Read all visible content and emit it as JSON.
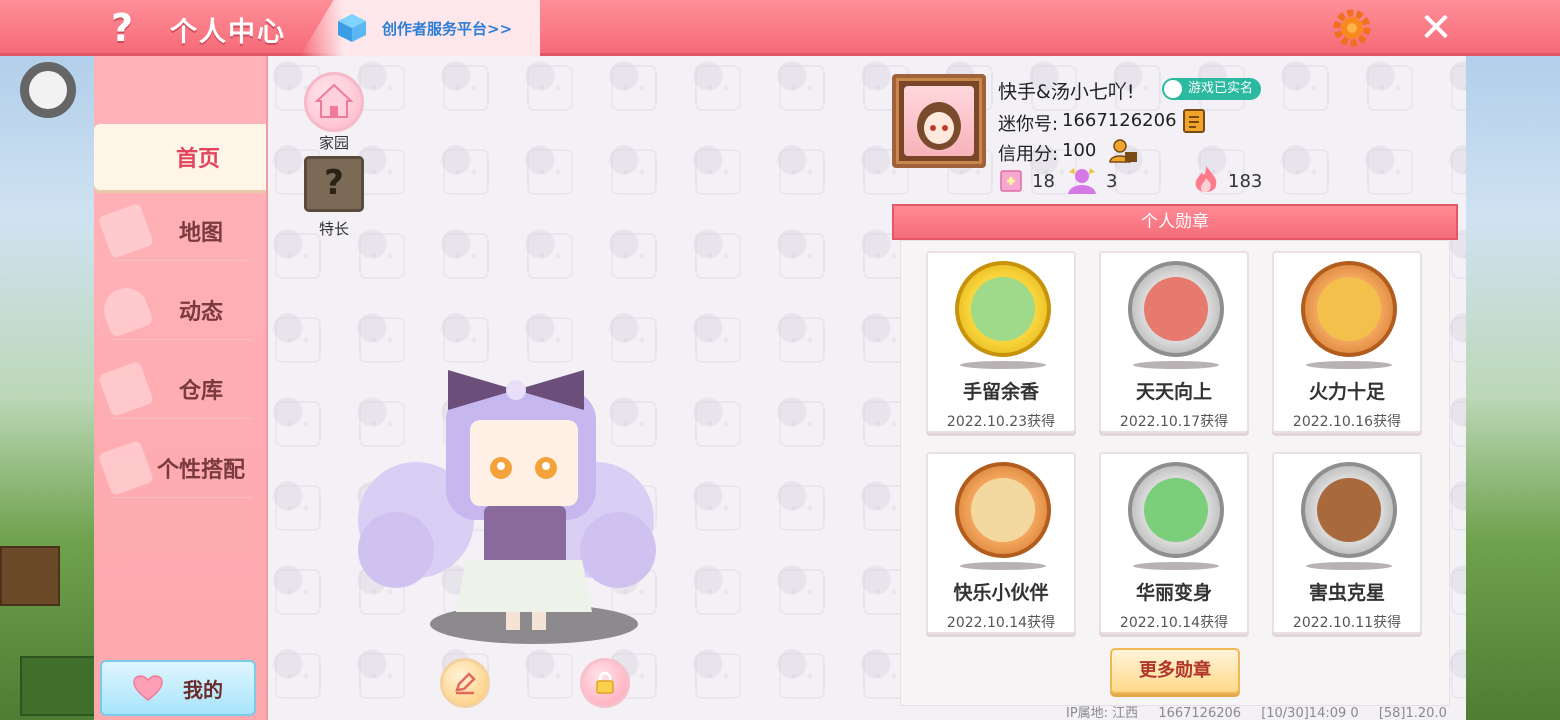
{
  "topbar": {
    "help_label": "?",
    "title": "个人中心",
    "creator_link": "创作者服务平台>>",
    "close_label": "✕"
  },
  "sidebar": {
    "items": [
      {
        "label": "首页",
        "active": true
      },
      {
        "label": "地图",
        "active": false
      },
      {
        "label": "动态",
        "active": false
      },
      {
        "label": "仓库",
        "active": false
      },
      {
        "label": "个性搭配",
        "active": false
      }
    ],
    "my_label": "我的"
  },
  "shortcuts": {
    "home_label": "家园",
    "talent_label": "特长",
    "talent_glyph": "?"
  },
  "profile": {
    "name": "快手&汤小七吖!",
    "verified_label": "游戏已实名",
    "id_label": "迷你号:",
    "id_value": "1667126206",
    "credit_label": "信用分:",
    "credit_value": "100",
    "stats": [
      {
        "icon": "flag-icon",
        "value": "18"
      },
      {
        "icon": "fans-icon",
        "value": "3"
      },
      {
        "icon": "flame-icon",
        "value": "183"
      }
    ]
  },
  "medals": {
    "header": "个人勋章",
    "items": [
      {
        "name": "手留余香",
        "date": "2022.10.23获得",
        "tier": "gold"
      },
      {
        "name": "天天向上",
        "date": "2022.10.17获得",
        "tier": "silver"
      },
      {
        "name": "火力十足",
        "date": "2022.10.16获得",
        "tier": "bronze"
      },
      {
        "name": "快乐小伙伴",
        "date": "2022.10.14获得",
        "tier": "bronze"
      },
      {
        "name": "华丽变身",
        "date": "2022.10.14获得",
        "tier": "silver"
      },
      {
        "name": "害虫克星",
        "date": "2022.10.11获得",
        "tier": "silver"
      }
    ],
    "more_label": "更多勋章"
  },
  "footer": {
    "ip": "IP属地: 江西",
    "uid": "1667126206",
    "time": "[10/30]14:09 0",
    "version": "[58]1.20.0"
  },
  "colors": {
    "topbar": "#f56b78",
    "sidebar": "#ffb3b8",
    "active_text": "#e2445c",
    "verified": "#2bb9a0",
    "creator_link": "#2d7ed8"
  }
}
